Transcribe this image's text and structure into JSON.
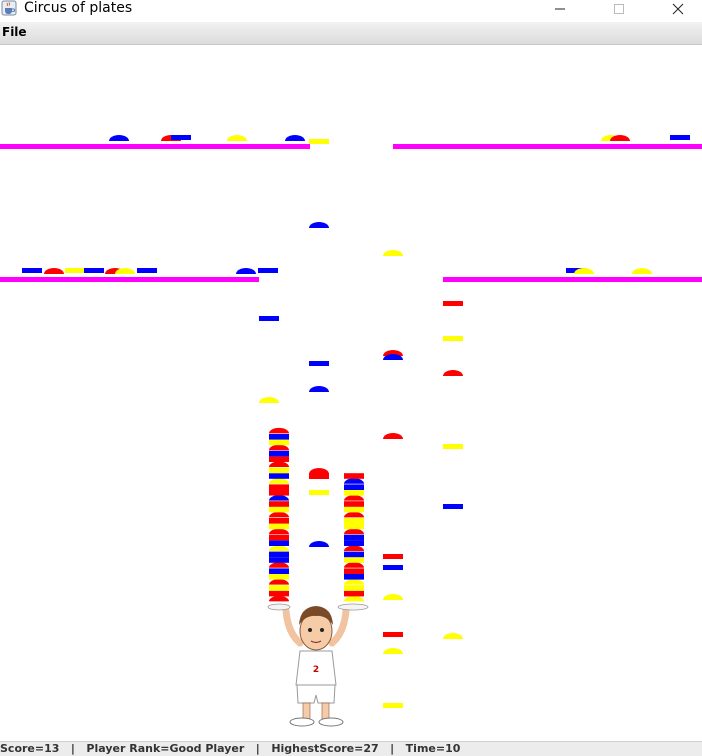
{
  "window": {
    "title": "Circus of plates",
    "minimize_icon": "minimize-icon",
    "maximize_icon": "maximize-icon",
    "close_icon": "close-icon"
  },
  "menu": {
    "file": "File"
  },
  "status": {
    "score_text": "Score=13",
    "rank_text": "Player Rank=Good Player",
    "highest_text": "HighestScore=27",
    "time_text": "Time=10"
  },
  "game": {
    "score": 13,
    "player_rank": "Good Player",
    "highest_score": 27,
    "time": 10,
    "colors": {
      "red": "#ff0000",
      "blue": "#0000ff",
      "yellow": "#ffff00",
      "shelf": "#ff00ff"
    },
    "clown": {
      "shirt_number": "2"
    },
    "left_stack": [
      "red",
      "red",
      "yellow",
      "red",
      "yellow",
      "blue",
      "red",
      "blue",
      "blue",
      "yellow",
      "blue",
      "red",
      "red",
      "yellow",
      "red",
      "red",
      "yellow",
      "red",
      "blue",
      "red",
      "red",
      "yellow",
      "blue",
      "yellow",
      "red",
      "red",
      "blue",
      "red",
      "yellow",
      "blue",
      "red"
    ],
    "right_stack": [
      "yellow",
      "red",
      "yellow",
      "yellow",
      "blue",
      "red",
      "red",
      "yellow",
      "blue",
      "red",
      "blue",
      "blue",
      "red",
      "yellow",
      "yellow",
      "red",
      "yellow",
      "red",
      "red",
      "yellow",
      "blue",
      "blue",
      "red"
    ]
  }
}
